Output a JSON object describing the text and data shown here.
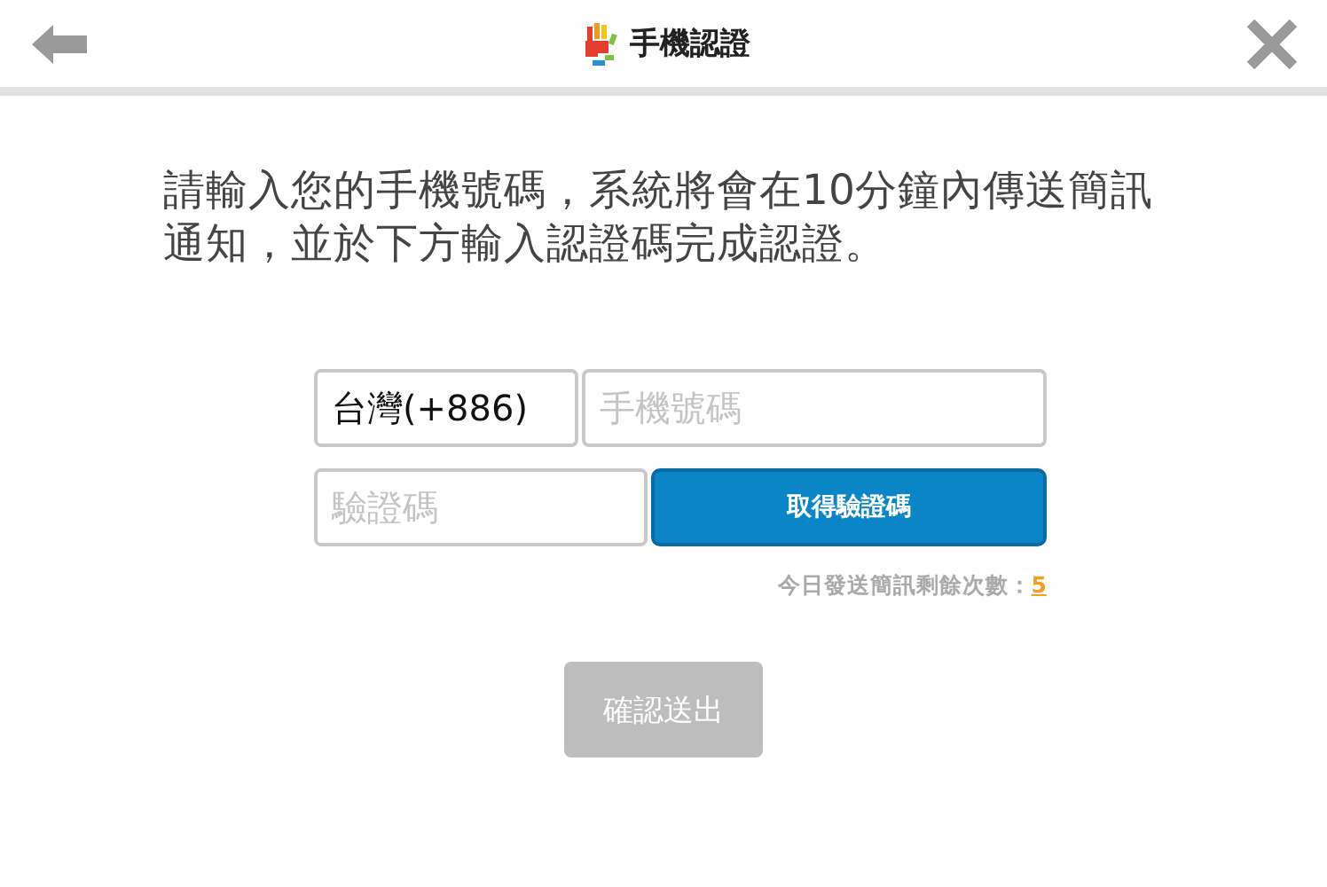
{
  "header": {
    "title": "手機認證"
  },
  "instructions": "請輸入您的手機號碼，系統將會在10分鐘內傳送簡訊通知，並於下方輸入認證碼完成認證。",
  "form": {
    "country": {
      "value": "台灣(+886)"
    },
    "phone": {
      "placeholder": "手機號碼"
    },
    "code": {
      "placeholder": "驗證碼"
    },
    "get_code_button": "取得驗證碼",
    "remaining_label": "今日發送簡訊剩餘次數：",
    "remaining_count": "5"
  },
  "submit": {
    "label": "確認送出",
    "disabled": true
  }
}
